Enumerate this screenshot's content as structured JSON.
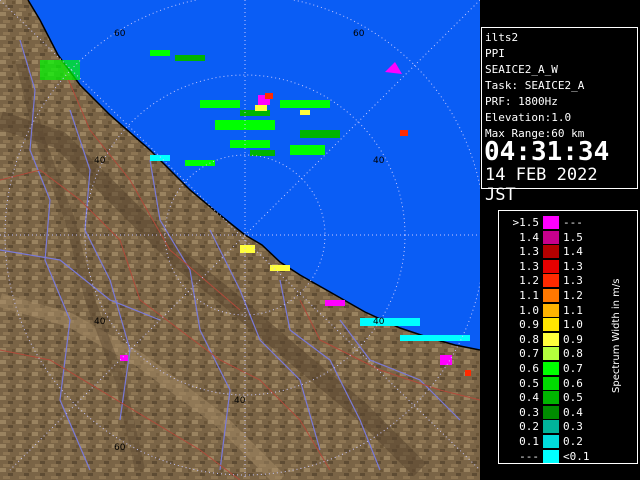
{
  "radar_display": {
    "range_ring_labels": [
      "60",
      "60",
      "40",
      "40",
      "40",
      "40",
      "40",
      "60"
    ],
    "colors": {
      "sea": "#0a5df5",
      "land": "#7a6446",
      "land_light": "#9a8360",
      "rings": "#c8c8ff",
      "rivers": "#7a7ad8",
      "borders": "#b04a3a"
    }
  },
  "info_panel": {
    "radar": "ilts2",
    "scan_type": "PPI",
    "schedule": "SEAICE2_A_W",
    "task": "Task: SEAICE2_A",
    "prf": "PRF: 1800Hz",
    "elevation": "Elevation:1.0",
    "max_range": "Max Range:60 km",
    "time": "04:31:34",
    "date": "14 FEB 2022 JST"
  },
  "legend": {
    "unit_label": "Spectrum Width in m/s",
    "rows": [
      {
        "low": ">1.5",
        "high": "---",
        "color": "#ff00ff"
      },
      {
        "low": "1.4",
        "high": "1.5",
        "color": "#c8008c"
      },
      {
        "low": "1.3",
        "high": "1.4",
        "color": "#b40000"
      },
      {
        "low": "1.3",
        "high": "1.3",
        "color": "#e60000"
      },
      {
        "low": "1.2",
        "high": "1.3",
        "color": "#ff2a00"
      },
      {
        "low": "1.1",
        "high": "1.2",
        "color": "#ff7800"
      },
      {
        "low": "1.0",
        "high": "1.1",
        "color": "#ffb400"
      },
      {
        "low": "0.9",
        "high": "1.0",
        "color": "#ffe600"
      },
      {
        "low": "0.8",
        "high": "0.9",
        "color": "#ffff3c"
      },
      {
        "low": "0.7",
        "high": "0.8",
        "color": "#b4ff3c"
      },
      {
        "low": "0.6",
        "high": "0.7",
        "color": "#00ff00"
      },
      {
        "low": "0.5",
        "high": "0.6",
        "color": "#00dc00"
      },
      {
        "low": "0.4",
        "high": "0.5",
        "color": "#00b400"
      },
      {
        "low": "0.3",
        "high": "0.4",
        "color": "#008c00"
      },
      {
        "low": "0.2",
        "high": "0.3",
        "color": "#00b49a"
      },
      {
        "low": "0.1",
        "high": "0.2",
        "color": "#00dcdc"
      },
      {
        "low": "---",
        "high": "<0.1",
        "color": "#00ffff"
      }
    ]
  }
}
